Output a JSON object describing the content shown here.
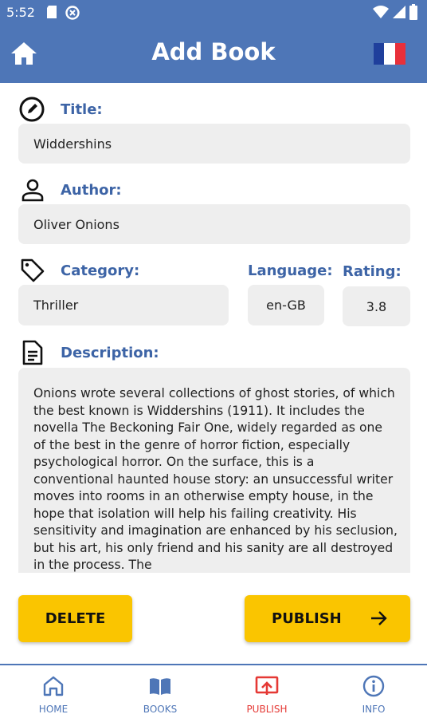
{
  "status_bar": {
    "time": "5:52"
  },
  "app_bar": {
    "title": "Add Book",
    "flag_colors": [
      "#1f3f9c",
      "#ffffff",
      "#e8303a"
    ]
  },
  "form": {
    "title_label": "Title:",
    "title_value": "Widdershins",
    "author_label": "Author:",
    "author_value": "Oliver Onions",
    "category_label": "Category:",
    "category_value": "Thriller",
    "language_label": "Language:",
    "language_value": "en-GB",
    "rating_label": "Rating:",
    "rating_value": "3.8",
    "description_label": "Description:",
    "description_value": "Onions wrote several collections of ghost stories, of which the best known is Widdershins (1911). It includes the novella The Beckoning Fair One, widely regarded as one of the best in the genre of horror fiction, especially psychological horror. On the surface, this is a conventional haunted house story: an unsuccessful writer moves into rooms in an otherwise empty house, in the hope that isolation will help his failing creativity. His sensitivity and imagination are enhanced by his seclusion, but his art, his only friend and his sanity are all destroyed in the process. The"
  },
  "actions": {
    "delete_label": "DELETE",
    "publish_label": "PUBLISH"
  },
  "bottom_nav": {
    "items": [
      {
        "label": "HOME",
        "icon": "home-icon"
      },
      {
        "label": "BOOKS",
        "icon": "book-icon"
      },
      {
        "label": "PUBLISH",
        "icon": "publish-icon",
        "active": true
      },
      {
        "label": "INFO",
        "icon": "info-icon"
      }
    ]
  },
  "colors": {
    "primary": "#4e76b7",
    "accent_button": "#fac500",
    "active_nav": "#e53935",
    "field_background": "#eeeeee"
  }
}
